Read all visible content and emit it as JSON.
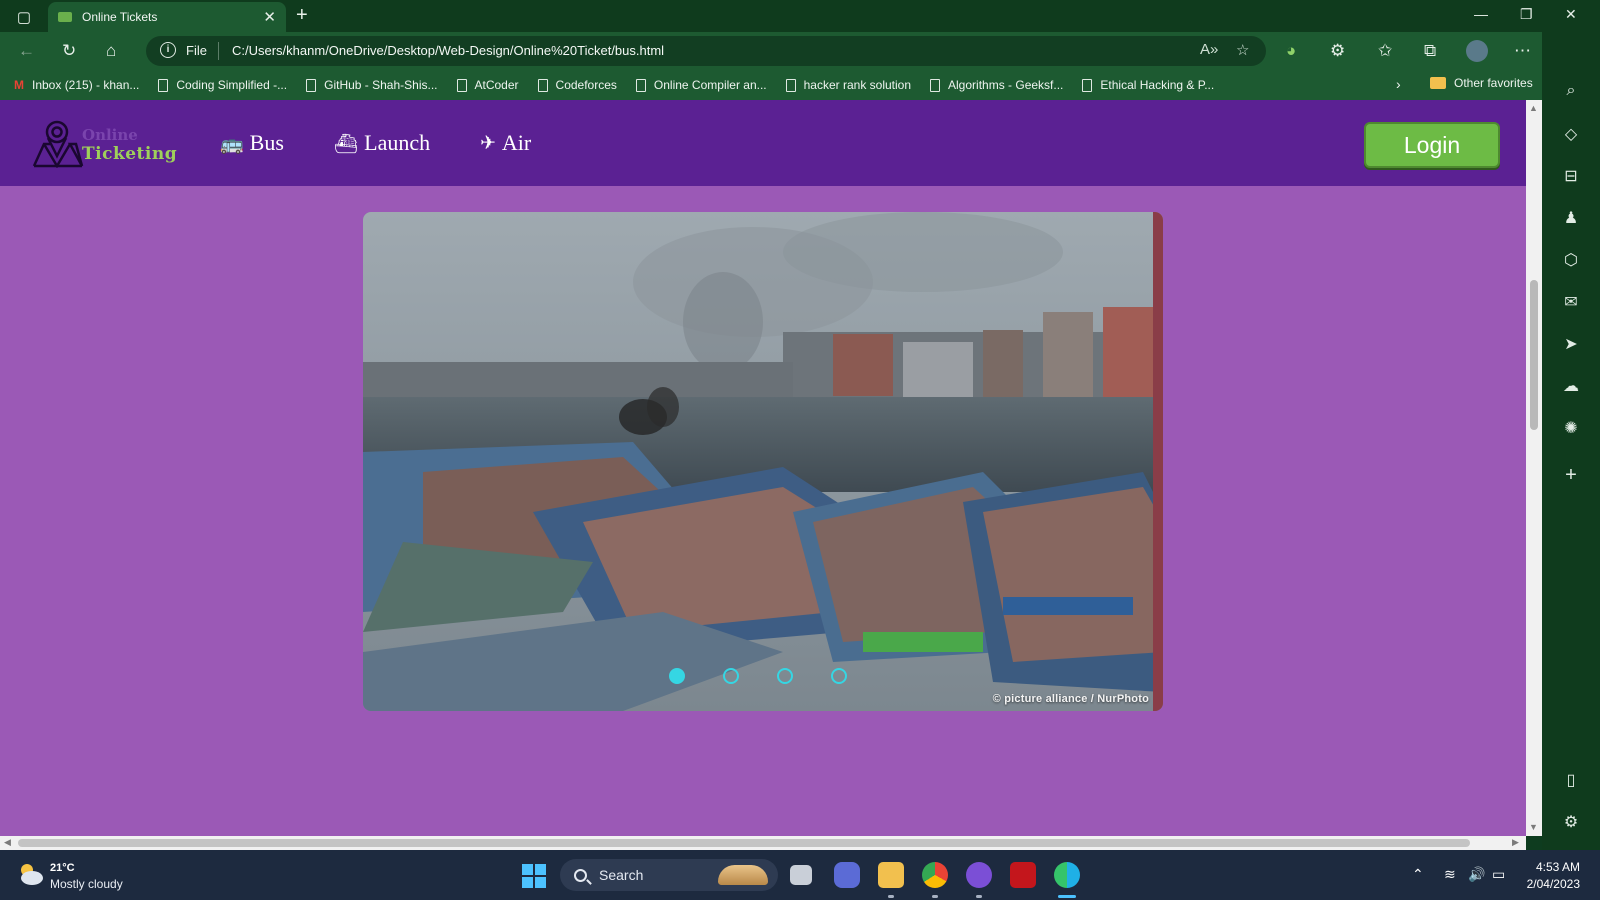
{
  "browser": {
    "tab_title": "Online Tickets",
    "address_scheme": "File",
    "address_url": "C:/Users/khanm/OneDrive/Desktop/Web-Design/Online%20Ticket/bus.html",
    "favorites": [
      {
        "label": "Inbox (215) - khan...",
        "icon": "gmail-icon"
      },
      {
        "label": "Coding Simplified -...",
        "icon": "page-icon"
      },
      {
        "label": "GitHub - Shah-Shis...",
        "icon": "page-icon"
      },
      {
        "label": "AtCoder",
        "icon": "page-icon"
      },
      {
        "label": "Codeforces",
        "icon": "page-icon"
      },
      {
        "label": "Online Compiler an...",
        "icon": "page-icon"
      },
      {
        "label": "hacker rank solution",
        "icon": "page-icon"
      },
      {
        "label": "Algorithms - Geeksf...",
        "icon": "page-icon"
      },
      {
        "label": "Ethical Hacking & P...",
        "icon": "page-icon"
      }
    ],
    "other_favorites": "Other favorites"
  },
  "site": {
    "logo_line1": "Online",
    "logo_line2": "Ticketing",
    "nav": [
      {
        "label": "Bus",
        "icon": "bus-icon"
      },
      {
        "label": "Launch",
        "icon": "ship-icon"
      },
      {
        "label": "Air",
        "icon": "plane-icon"
      }
    ],
    "login_label": "Login",
    "carousel": {
      "slide_count": 4,
      "active_index": 0,
      "credit": "© picture alliance / NurPhoto"
    }
  },
  "taskbar": {
    "weather_temp": "21°C",
    "weather_desc": "Mostly cloudy",
    "search_label": "Search",
    "time": "4:53 AM",
    "date": "2/04/2023"
  },
  "colors": {
    "navbar": "#5b2193",
    "page_bg": "#9b59b6",
    "login_btn": "#6dbb45",
    "carousel_dot": "#35d6e3",
    "browser_chrome": "#1d5a31"
  }
}
